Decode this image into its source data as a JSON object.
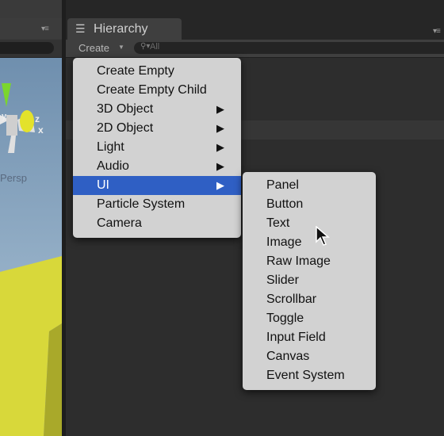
{
  "hierarchy": {
    "tab_title": "Hierarchy",
    "tab_icon": "list-icon",
    "create_label": "Create",
    "search_placeholder": "All"
  },
  "scene": {
    "gizmo_axes": {
      "z": "z",
      "x": "x",
      "y": "y"
    },
    "projection_label": "Persp"
  },
  "create_menu": {
    "items": [
      {
        "label": "Create Empty",
        "submenu": false,
        "selected": false
      },
      {
        "label": "Create Empty Child",
        "submenu": false,
        "selected": false
      },
      {
        "label": "3D Object",
        "submenu": true,
        "selected": false
      },
      {
        "label": "2D Object",
        "submenu": true,
        "selected": false
      },
      {
        "label": "Light",
        "submenu": true,
        "selected": false
      },
      {
        "label": "Audio",
        "submenu": true,
        "selected": false
      },
      {
        "label": "UI",
        "submenu": true,
        "selected": true
      },
      {
        "label": "Particle System",
        "submenu": false,
        "selected": false
      },
      {
        "label": "Camera",
        "submenu": false,
        "selected": false
      }
    ],
    "arrow_glyph": "▶"
  },
  "ui_submenu": {
    "items": [
      {
        "label": "Panel"
      },
      {
        "label": "Button"
      },
      {
        "label": "Text"
      },
      {
        "label": "Image"
      },
      {
        "label": "Raw Image"
      },
      {
        "label": "Slider"
      },
      {
        "label": "Scrollbar"
      },
      {
        "label": "Toggle"
      },
      {
        "label": "Input Field"
      },
      {
        "label": "Canvas"
      },
      {
        "label": "Event System"
      }
    ]
  },
  "colors": {
    "menu_background": "#d2d2d2",
    "selection": "#2f5fc4",
    "panel_dark": "#2d2d2d"
  }
}
